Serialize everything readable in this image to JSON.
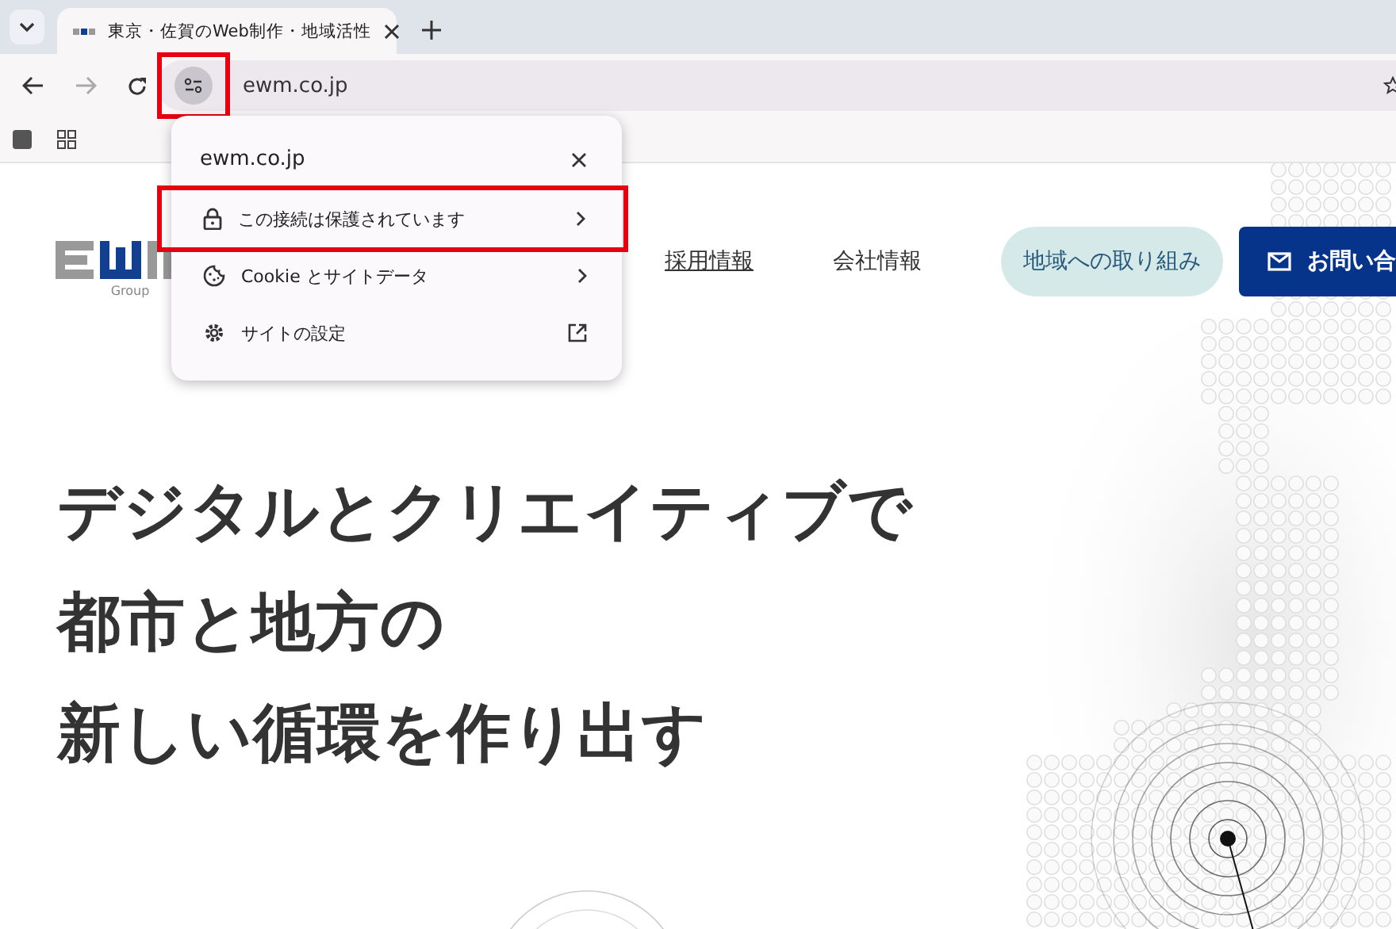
{
  "browser": {
    "tab": {
      "title": "東京・佐賀のWeb制作・地域活性",
      "selected": true
    },
    "address": "ewm.co.jp",
    "site_info_highlighted": true
  },
  "site_info_popup": {
    "title": "ewm.co.jp",
    "items": [
      {
        "label": "この接続は保護されています",
        "kind": "submenu",
        "highlighted": true
      },
      {
        "label": "Cookie とサイトデータ",
        "kind": "submenu",
        "highlighted": false
      },
      {
        "label": "サイトの設定",
        "kind": "external",
        "highlighted": false
      }
    ]
  },
  "site": {
    "logo_caption": "Group",
    "nav": [
      {
        "label": "採用情報",
        "kind": "link"
      },
      {
        "label": "会社情報",
        "kind": "link"
      },
      {
        "label": "地域への取り組み",
        "kind": "pill"
      },
      {
        "label": "お問い合",
        "kind": "cta"
      }
    ],
    "hero_lines": [
      "デジタルとクリエイティブで",
      "都市と地方の",
      "新しい循環を作り出す"
    ]
  }
}
